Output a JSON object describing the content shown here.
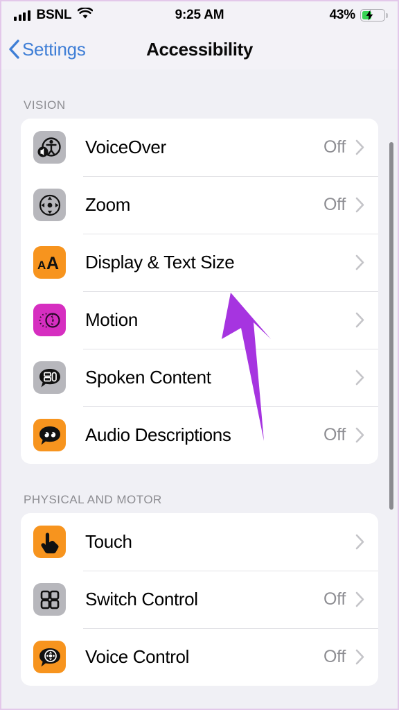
{
  "status_bar": {
    "carrier": "BSNL",
    "time": "9:25 AM",
    "battery_percent": "43%",
    "battery_level": 43,
    "charging": true,
    "signal_bars": 4,
    "wifi": true
  },
  "nav": {
    "back_label": "Settings",
    "title": "Accessibility"
  },
  "sections": [
    {
      "header": "VISION",
      "rows": [
        {
          "label": "VoiceOver",
          "value": "Off",
          "icon": "voiceover-icon",
          "icon_bg": "#b7b7bc"
        },
        {
          "label": "Zoom",
          "value": "Off",
          "icon": "zoom-icon",
          "icon_bg": "#b7b7bc"
        },
        {
          "label": "Display & Text Size",
          "value": "",
          "icon": "display-text-size-icon",
          "icon_bg": "#f7941e"
        },
        {
          "label": "Motion",
          "value": "",
          "icon": "motion-icon",
          "icon_bg": "#d62ec0"
        },
        {
          "label": "Spoken Content",
          "value": "",
          "icon": "spoken-content-icon",
          "icon_bg": "#b7b7bc"
        },
        {
          "label": "Audio Descriptions",
          "value": "Off",
          "icon": "audio-descriptions-icon",
          "icon_bg": "#f7941e"
        }
      ]
    },
    {
      "header": "PHYSICAL AND MOTOR",
      "rows": [
        {
          "label": "Touch",
          "value": "",
          "icon": "touch-icon",
          "icon_bg": "#f7941e"
        },
        {
          "label": "Switch Control",
          "value": "Off",
          "icon": "switch-control-icon",
          "icon_bg": "#b7b7bc"
        },
        {
          "label": "Voice Control",
          "value": "Off",
          "icon": "voice-control-icon",
          "icon_bg": "#f7941e"
        }
      ]
    }
  ],
  "annotation": {
    "arrow_color": "#a634e0",
    "points_to": "Display & Text Size"
  },
  "colors": {
    "page_background": "#f0f0f5",
    "card_background": "#ffffff",
    "tint_blue": "#3e7ed6",
    "secondary_text": "#8e8e93",
    "battery_green": "#38d454"
  }
}
